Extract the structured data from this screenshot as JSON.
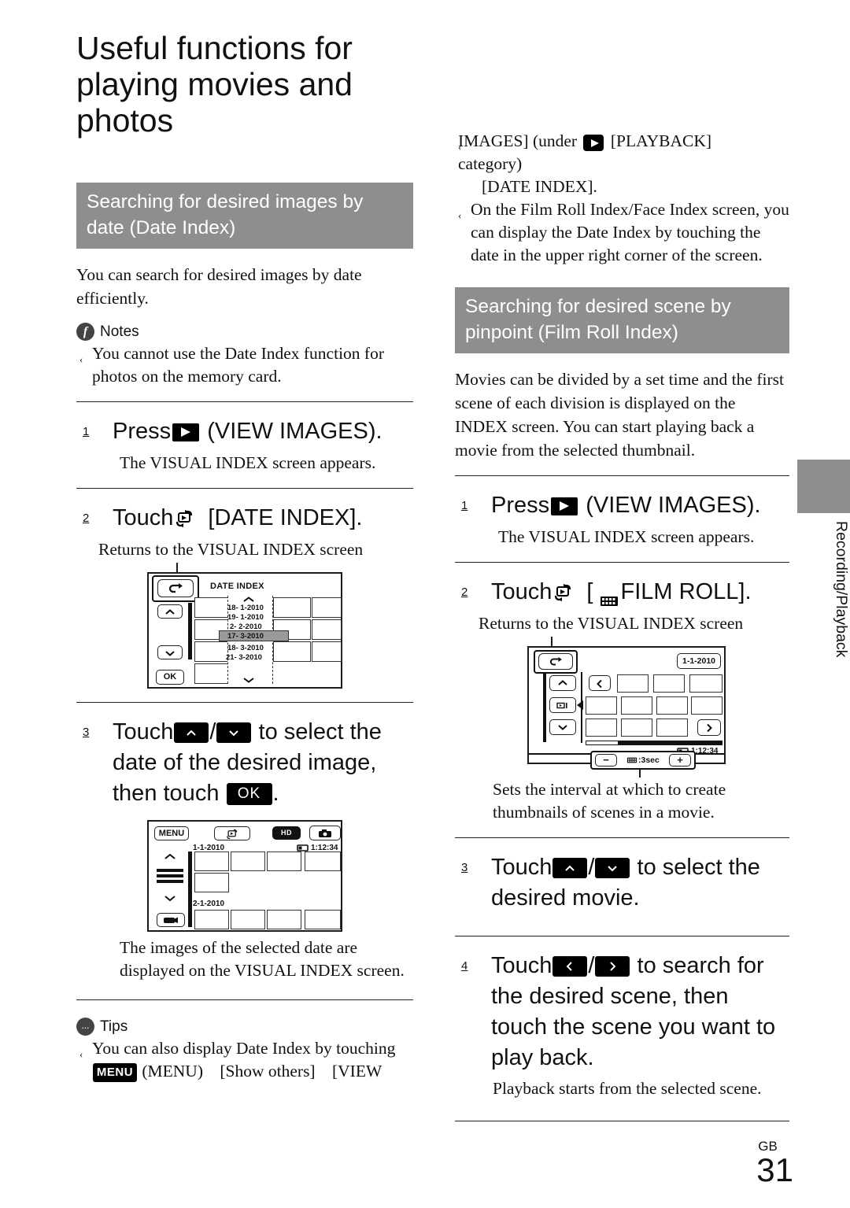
{
  "page": {
    "title": "Useful functions for playing movies and photos",
    "page_label": "GB",
    "page_number": "31",
    "side_tab": "Recording/Playback"
  },
  "left_column": {
    "section_heading": "Searching for desired images by date (Date Index)",
    "intro": "You can search for desired images by date efficiently.",
    "notes": {
      "badge": "f",
      "label": "Notes",
      "items": [
        "You cannot use the Date Index function for photos on the memory card."
      ]
    },
    "step1": {
      "number": "1",
      "verb": "Press",
      "icon": "view-images-button-icon",
      "tail": "(VIEW IMAGES).",
      "result": "The VISUAL INDEX screen appears."
    },
    "step2": {
      "number": "2",
      "verb": "Touch",
      "icon": "touch-loop-icon",
      "tail": "[DATE INDEX].",
      "callout": "Returns to the VISUAL INDEX screen"
    },
    "date_index_screen": {
      "title": "DATE INDEX",
      "back_button": "back-arrow-icon",
      "up_button": "up-chevron-icon",
      "down_button": "down-chevron-icon",
      "ok_button": "OK",
      "dates": [
        "18- 1-2010",
        "19- 1-2010",
        "2- 2-2010",
        "17- 3-2010",
        "18- 3-2010",
        "21- 3-2010"
      ],
      "selected_date": "17- 3-2010"
    },
    "step3": {
      "number": "3",
      "text_a": "Touch",
      "key_up": "up-chevron-key",
      "slash": "/",
      "key_down": "down-chevron-key",
      "text_b": "to select the date of the desired image, then touch",
      "key_ok": "OK",
      "period": "."
    },
    "visual_index_screen": {
      "menu_button": "MENU",
      "touch_loop_icon": "touch-loop-icon",
      "hd_badge": "HD",
      "photo_icon": "camera-icon",
      "date_1": "1-1-2010",
      "duration": "1:12:34",
      "date_2": "2-1-2010"
    },
    "step3_result": "The images of the selected date are displayed on the VISUAL INDEX screen.",
    "tips": {
      "badge": "...",
      "label": "Tips",
      "items": [
        {
          "lead": "You can also display Date Index by touching",
          "menu_key": "MENU",
          "trail": "(MENU)",
          "crumb_1": "[Show others]",
          "crumb_2": "[VIEW"
        }
      ]
    }
  },
  "right_column": {
    "continued_note": {
      "line_1_a": "IMAGES] (under",
      "line_1_icon": "playback-category-icon",
      "line_1_b": "[PLAYBACK] category)",
      "line_2": "[DATE INDEX]."
    },
    "extra_note": "On the Film Roll Index/Face Index screen, you can display the Date Index by touching the date in the upper right corner of the screen.",
    "section_heading": "Searching for desired scene by pinpoint (Film Roll Index)",
    "intro": "Movies can be divided by a set time and the first scene of each division is displayed on the INDEX screen. You can start playing back a movie from the selected thumbnail.",
    "step1": {
      "number": "1",
      "verb": "Press",
      "icon": "view-images-button-icon",
      "tail": "(VIEW IMAGES).",
      "result": "The VISUAL INDEX screen appears."
    },
    "step2": {
      "number": "2",
      "verb": "Touch",
      "icon": "touch-loop-icon",
      "bracket_open": "[",
      "film_icon": "film-roll-icon",
      "tail": "FILM ROLL].",
      "callout": "Returns to the VISUAL INDEX screen"
    },
    "film_roll_screen": {
      "back_button": "back-arrow-icon",
      "date": "1-1-2010",
      "up_button": "up-chevron-icon",
      "down_button": "down-chevron-icon",
      "prev_button": "prev-chevron-icon",
      "next_button": "next-chevron-icon",
      "duration": "1:12:34",
      "minus_button": "−",
      "interval_label": ":3sec",
      "plus_button": "+"
    },
    "film_roll_caption": "Sets the interval at which to create thumbnails of scenes in a movie.",
    "step3": {
      "number": "3",
      "text_a": "Touch",
      "key_up": "up-chevron-key",
      "slash": "/",
      "key_down": "down-chevron-key",
      "text_b": "to select the desired movie."
    },
    "step4": {
      "number": "4",
      "text_a": "Touch",
      "key_left": "left-chevron-key",
      "slash": "/",
      "key_right": "right-chevron-key",
      "text_b": "to search for the desired scene, then touch the scene you want to play back.",
      "result": "Playback starts from the selected scene."
    }
  },
  "colors": {
    "heading_bg": "#8e8e8e",
    "heading_text": "#ffffff",
    "body_text": "#111111",
    "key_bg": "#000000",
    "highlight_row": "#9a9a9a"
  }
}
